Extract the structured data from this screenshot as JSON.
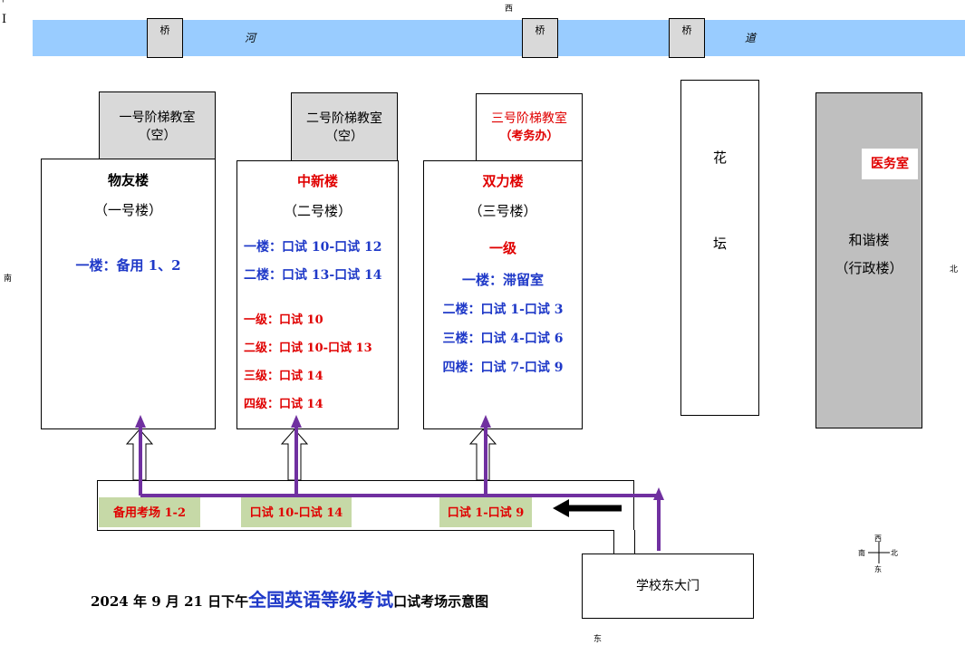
{
  "top_marks": {
    "corner": "I",
    "dot": "'"
  },
  "compass_labels": {
    "top": "西",
    "left": "南",
    "right": "北",
    "bottom": "东"
  },
  "river": {
    "label_left": "河",
    "label_right": "道",
    "bridge": "桥"
  },
  "buildings": {
    "b1_lecture": {
      "line1": "一号阶梯教室",
      "line2": "（空）"
    },
    "b2_lecture": {
      "line1": "二号阶梯教室",
      "line2": "（空）"
    },
    "b3_lecture": {
      "line1": "三号阶梯教室",
      "line2": "（考务办）"
    },
    "b1": {
      "name": "物友楼",
      "sub": "（一号楼）",
      "rows": [
        "一楼：备用 1、2"
      ]
    },
    "b2": {
      "name": "中新楼",
      "sub": "（二号楼）",
      "blue_rows": [
        "一楼：口试 10-口试 12",
        "二楼：口试 13-口试 14"
      ],
      "red_rows": [
        "一级：口试 10",
        "二级：口试 10-口试 13",
        "三级：口试 14",
        "四级：口试 14"
      ]
    },
    "b3": {
      "name": "双力楼",
      "sub": "（三号楼）",
      "level": "一级",
      "rows": [
        "一楼：滞留室",
        "二楼：口试 1-口试 3",
        "三楼：口试 4-口试 6",
        "四楼：口试 7-口试 9"
      ]
    },
    "flower": {
      "line1": "花",
      "line2": "坛"
    },
    "admin": {
      "name": "和谐楼",
      "sub": "（行政楼）",
      "clinic": "医务室"
    }
  },
  "path_labels": [
    "备用考场 1-2",
    "口试 10-口试 14",
    "口试 1-口试 9"
  ],
  "gate": "学校东大门",
  "title": {
    "part1": "2024 年 9 月 21 日下午",
    "part2": "全国英语等级考试",
    "part3": "口试考场示意图"
  },
  "mini_compass": {
    "n": "西",
    "s": "东",
    "w": "南",
    "e": "北"
  },
  "colors": {
    "river": "#99ccff",
    "path": "#7030a0",
    "red": "#e00000",
    "blue": "#1f39c8",
    "green": "#c6d9a7"
  }
}
